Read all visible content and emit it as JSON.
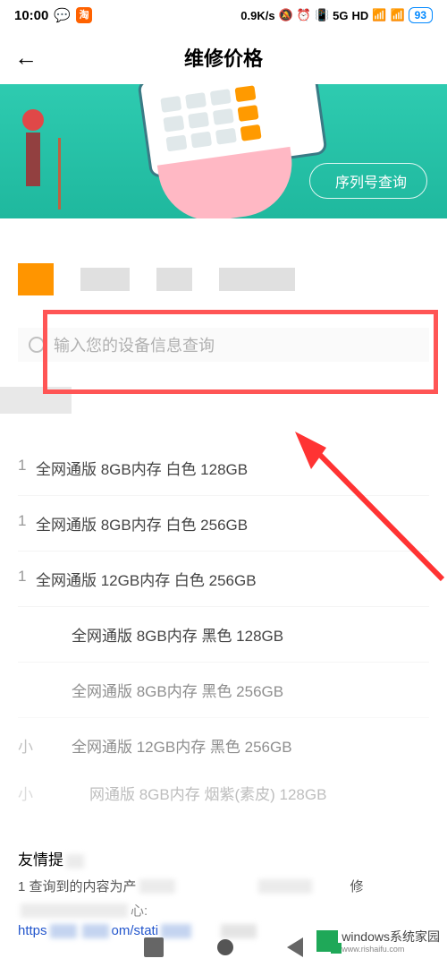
{
  "statusBar": {
    "time": "10:00",
    "netSpeed": "0.9K/s",
    "battery": "93"
  },
  "header": {
    "title": "维修价格"
  },
  "banner": {
    "serialBtn": "序列号查询"
  },
  "search": {
    "placeholder": "输入您的设备信息查询"
  },
  "devices": [
    {
      "prefix": "1",
      "text": "全网通版 8GB内存 白色 128GB"
    },
    {
      "prefix": "1",
      "text": "全网通版 8GB内存 白色 256GB"
    },
    {
      "prefix": "1",
      "text": "全网通版 12GB内存 白色 256GB"
    },
    {
      "prefix": "",
      "text": "全网通版 8GB内存 黑色 128GB"
    },
    {
      "prefix": "",
      "text": "全网通版 8GB内存 黑色 256GB"
    },
    {
      "prefix": "",
      "text": "全网通版 12GB内存 黑色 256GB"
    },
    {
      "prefix": "",
      "text": "网通版 8GB内存 烟紫(素皮) 128GB"
    }
  ],
  "tips": {
    "title": "友情提",
    "line1_a": "1 查询到的内容为产",
    "line1_b": "修",
    "link": "https",
    "linkMid": "om/stati"
  },
  "watermark": {
    "big": "windows系统家园",
    "small": "www.rishaifu.com"
  }
}
